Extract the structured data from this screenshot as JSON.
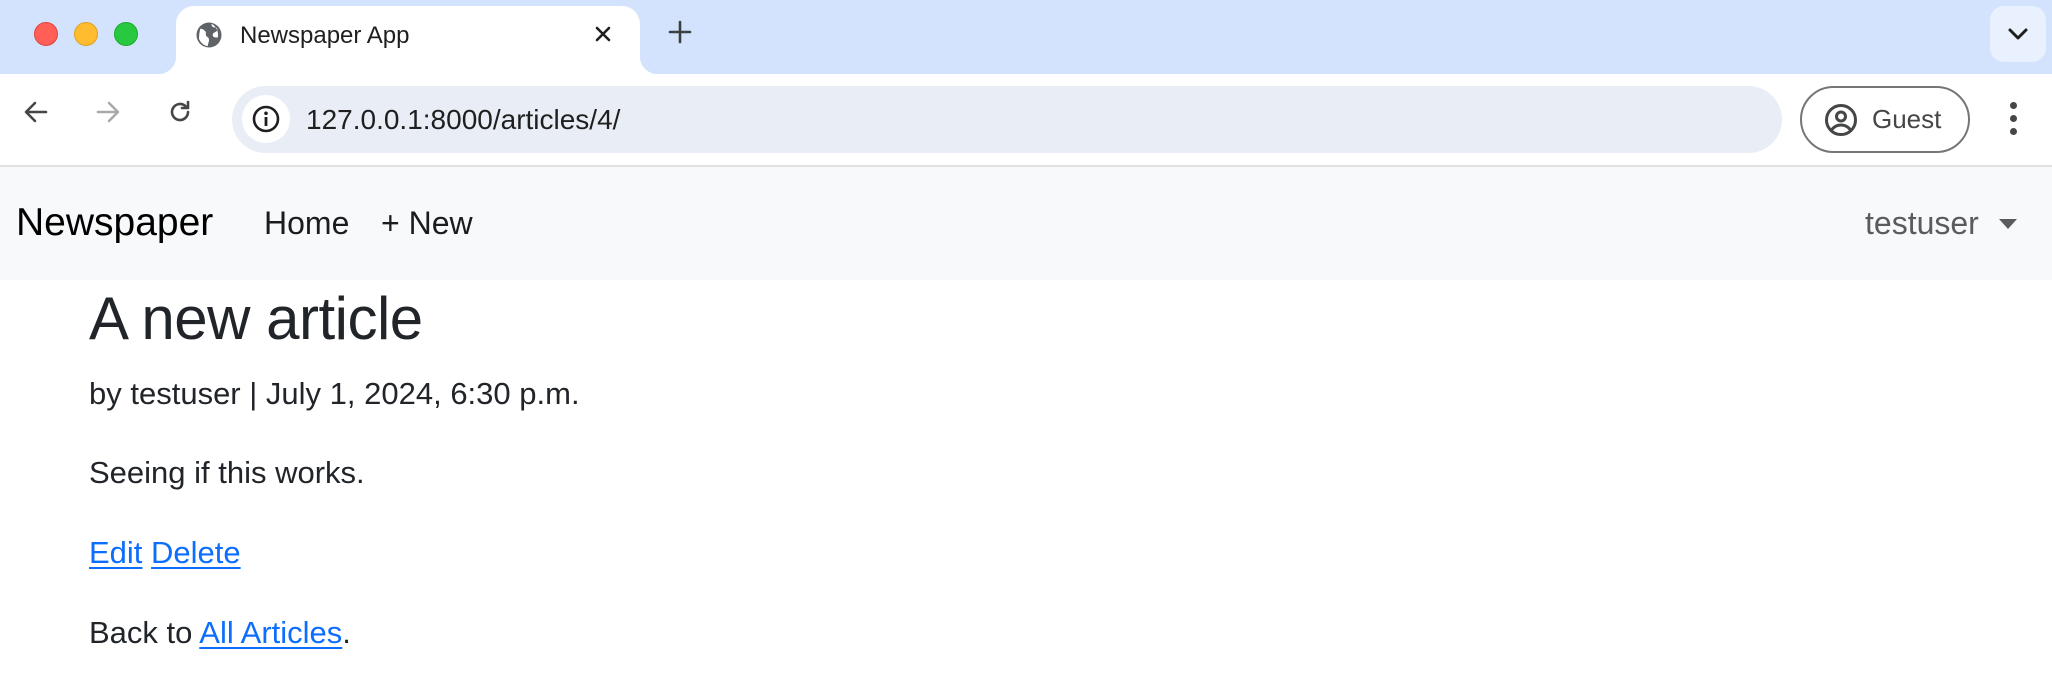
{
  "browser": {
    "tab": {
      "title": "Newspaper App",
      "favicon": "globe-icon"
    },
    "url": "127.0.0.1:8000/articles/4/",
    "profile_label": "Guest",
    "icons": {
      "back": "arrow-left-icon",
      "forward": "arrow-right-icon",
      "reload": "reload-icon",
      "site_info": "info-icon",
      "profile": "account-circle-icon",
      "menu": "kebab-menu-icon",
      "new_tab": "plus-icon",
      "tab_search": "chevron-down-icon",
      "close_tab": "close-icon"
    }
  },
  "navbar": {
    "brand": "Newspaper",
    "links": [
      {
        "label": "Home"
      },
      {
        "label": "+ New"
      }
    ],
    "user_menu": {
      "label": "testuser"
    }
  },
  "article": {
    "title": "A new article",
    "byline_prefix": "by ",
    "author": "testuser",
    "separator": " | ",
    "date": "July 1, 2024, 6:30 p.m.",
    "body": "Seeing if this works.",
    "actions": [
      {
        "label": "Edit"
      },
      {
        "label": "Delete"
      }
    ],
    "back": {
      "prefix": "Back to ",
      "link_label": "All Articles",
      "suffix": "."
    }
  },
  "colors": {
    "link": "#0d6efd",
    "text": "#212529",
    "navbar_bg": "#f8f9fa",
    "tabstrip_bg": "#d3e3fd"
  }
}
